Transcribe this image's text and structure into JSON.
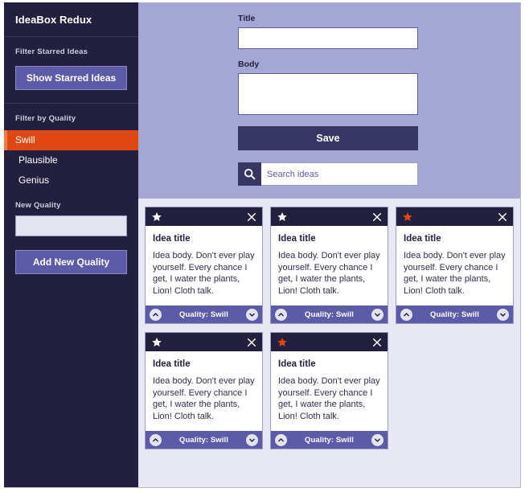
{
  "sidebar": {
    "title": "IdeaBox Redux",
    "starred_section": {
      "label": "Filter Starred Ideas",
      "button_label": "Show Starred Ideas"
    },
    "quality_section": {
      "label": "Filter by Quality",
      "items": [
        {
          "label": "Swill",
          "active": true
        },
        {
          "label": "Plausible",
          "active": false
        },
        {
          "label": "Genius",
          "active": false
        }
      ]
    },
    "new_quality": {
      "label": "New Quality",
      "input_value": "",
      "input_placeholder": "",
      "button_label": "Add New Quality"
    }
  },
  "form": {
    "title_label": "Title",
    "title_value": "",
    "title_placeholder": "",
    "body_label": "Body",
    "body_value": "",
    "body_placeholder": "",
    "save_label": "Save",
    "search_value": "",
    "search_placeholder": "Search ideas",
    "search_icon": "search-icon"
  },
  "colors": {
    "sidebar_bg": "#221f3f",
    "accent_orange": "#e04712",
    "accent_orange_light": "#f07a4a",
    "button_purple": "#5b5ba8",
    "form_bg": "#a4a6d4",
    "save_bg": "#373562",
    "content_bg": "#e8e8f4",
    "star_on": "#e04712",
    "star_off": "#ffffff"
  },
  "cards": [
    {
      "starred": false,
      "title": "Idea title",
      "body": "Idea body. Don't ever play yourself. Every chance I get, I water the plants, Lion! Cloth talk.",
      "quality_label": "Quality: Swill",
      "upvote_icon": "chevron-up-icon",
      "downvote_icon": "chevron-down-icon",
      "close_icon": "close-icon",
      "star_icon": "star-icon"
    },
    {
      "starred": false,
      "title": "Idea title",
      "body": "Idea body. Don't ever play yourself. Every chance I get, I water the plants, Lion! Cloth talk.",
      "quality_label": "Quality: Swill",
      "upvote_icon": "chevron-up-icon",
      "downvote_icon": "chevron-down-icon",
      "close_icon": "close-icon",
      "star_icon": "star-icon"
    },
    {
      "starred": true,
      "title": "Idea title",
      "body": "Idea body. Don't ever play yourself. Every chance I get, I water the plants, Lion! Cloth talk.",
      "quality_label": "Quality: Swill",
      "upvote_icon": "chevron-up-icon",
      "downvote_icon": "chevron-down-icon",
      "close_icon": "close-icon",
      "star_icon": "star-icon"
    },
    {
      "starred": false,
      "title": "Idea title",
      "body": "Idea body. Don't ever play yourself. Every chance I get, I water the plants, Lion! Cloth talk.",
      "quality_label": "Quality: Swill",
      "upvote_icon": "chevron-up-icon",
      "downvote_icon": "chevron-down-icon",
      "close_icon": "close-icon",
      "star_icon": "star-icon"
    },
    {
      "starred": true,
      "title": "Idea title",
      "body": "Idea body. Don't ever play yourself. Every chance I get, I water the plants, Lion! Cloth talk.",
      "quality_label": "Quality: Swill",
      "upvote_icon": "chevron-up-icon",
      "downvote_icon": "chevron-down-icon",
      "close_icon": "close-icon",
      "star_icon": "star-icon"
    }
  ]
}
